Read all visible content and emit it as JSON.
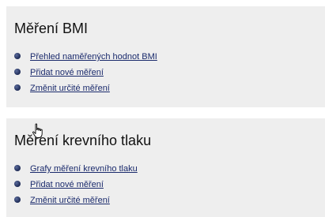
{
  "sections": [
    {
      "title": "Měření BMI",
      "links": [
        "Přehled naměřených hodnot BMI",
        "Přidat nové měření",
        "Změnit určité měření"
      ]
    },
    {
      "title": "Měření krevního tlaku",
      "links": [
        "Grafy měření krevního tlaku",
        "Přidat nové měření",
        "Změnit určité měření"
      ]
    }
  ],
  "icons": {
    "bullet": "bullet-icon",
    "cursor": "hand-pointer-icon"
  },
  "colors": {
    "panel_background": "#eeeeee",
    "link": "#1a2a6c",
    "bullet": "#1d2a55"
  }
}
